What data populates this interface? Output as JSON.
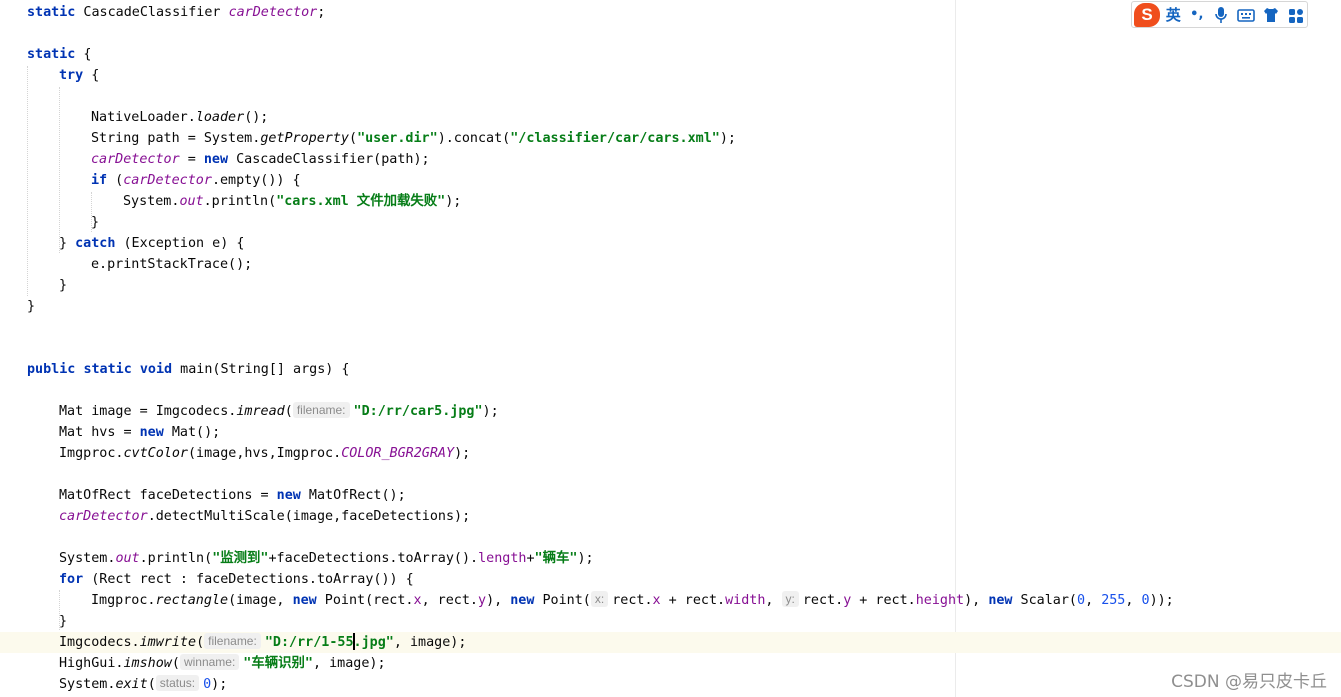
{
  "editor": {
    "l1": {
      "a": "static",
      "b": " CascadeClassifier ",
      "c": "carDetector",
      "d": ";"
    },
    "l3": {
      "a": "static",
      "b": " {"
    },
    "l4": {
      "a": "try",
      "b": " {"
    },
    "l6": {
      "a": "NativeLoader.",
      "b": "loader",
      "c": "();"
    },
    "l7": {
      "a": "String path = System.",
      "b": "getProperty",
      "c": "(",
      "d": "\"user.dir\"",
      "e": ").concat(",
      "f": "\"/classifier/car/cars.xml\"",
      "g": ");"
    },
    "l8": {
      "a": "carDetector",
      "b": " = ",
      "c": "new",
      "d": " CascadeClassifier(path);"
    },
    "l9": {
      "a": "if",
      "b": " (",
      "c": "carDetector",
      "d": ".empty()) {"
    },
    "l10": {
      "a": "System.",
      "b": "out",
      "c": ".println(",
      "d": "\"cars.xml 文件加载失败\"",
      "e": ");"
    },
    "l11": {
      "a": "}"
    },
    "l12": {
      "a": "} ",
      "b": "catch",
      "c": " (Exception e) {"
    },
    "l13": {
      "a": "e.printStackTrace();"
    },
    "l14": {
      "a": "}"
    },
    "l15": {
      "a": "}"
    },
    "l18": {
      "a": "public",
      "b": " ",
      "c": "static",
      "d": " ",
      "e": "void",
      "f": " main(String[] args) {"
    },
    "l20": {
      "a": "Mat image = Imgcodecs.",
      "b": "imread",
      "c": "(",
      "hint": "filename:",
      "d": "\"D:/rr/car5.jpg\"",
      "e": ");"
    },
    "l21": {
      "a": "Mat hvs = ",
      "b": "new",
      "c": " Mat();"
    },
    "l22": {
      "a": "Imgproc.",
      "b": "cvtColor",
      "c": "(image,hvs,Imgproc.",
      "d": "COLOR_BGR2GRAY",
      "e": ");"
    },
    "l24": {
      "a": "MatOfRect faceDetections = ",
      "b": "new",
      "c": " MatOfRect();"
    },
    "l25": {
      "a": "carDetector",
      "b": ".detectMultiScale(image,faceDetections);"
    },
    "l27": {
      "a": "System.",
      "b": "out",
      "c": ".println(",
      "d": "\"监测到\"",
      "e": "+faceDetections.toArray().",
      "f": "length",
      "g": "+",
      "h": "\"辆车\"",
      "i": ");"
    },
    "l28": {
      "a": "for",
      "b": " (Rect rect : faceDetections.toArray()) {"
    },
    "l29": {
      "a": "Imgproc.",
      "b": "rectangle",
      "c": "(image, ",
      "d": "new",
      "e": " Point(rect.",
      "f": "x",
      "g": ", rect.",
      "h": "y",
      "i": "), ",
      "j": "new",
      "k": " Point(",
      "hint1": "x:",
      "l": "rect.",
      "m": "x",
      "n": " + rect.",
      "o": "width",
      "p": ",",
      "hint2": "y:",
      "q": "rect.",
      "r": "y",
      "s": " + rect.",
      "t": "height",
      "u": "), ",
      "v": "new",
      "w": " Scalar(",
      "n1": "0",
      "x": ", ",
      "n2": "255",
      "y": ", ",
      "n3": "0",
      "z": "));"
    },
    "l30": {
      "a": "}"
    },
    "l31": {
      "a": "Imgcodecs.",
      "b": "imwrite",
      "c": "(",
      "hint": "filename:",
      "d1": "\"D:/rr/1-55",
      "d2": ".jpg\"",
      "e": ", image);"
    },
    "l32": {
      "a": "HighGui.",
      "b": "imshow",
      "c": "(",
      "hint": "winname:",
      "d": "\"车辆识别\"",
      "e": ", image);"
    },
    "l33": {
      "a": "System.",
      "b": "exit",
      "c": "(",
      "hint": "status:",
      "d": "0",
      "e": ");"
    }
  },
  "ime": {
    "brand_letter": "S",
    "lang": "英",
    "punct": "•,",
    "icons": [
      "microphone-icon",
      "keyboard-icon",
      "shirt-skin-icon",
      "app-grid-icon"
    ],
    "brand_color": "#f04e1d",
    "icon_color": "#1565c0"
  },
  "watermark": "CSDN @易只皮卡丘"
}
